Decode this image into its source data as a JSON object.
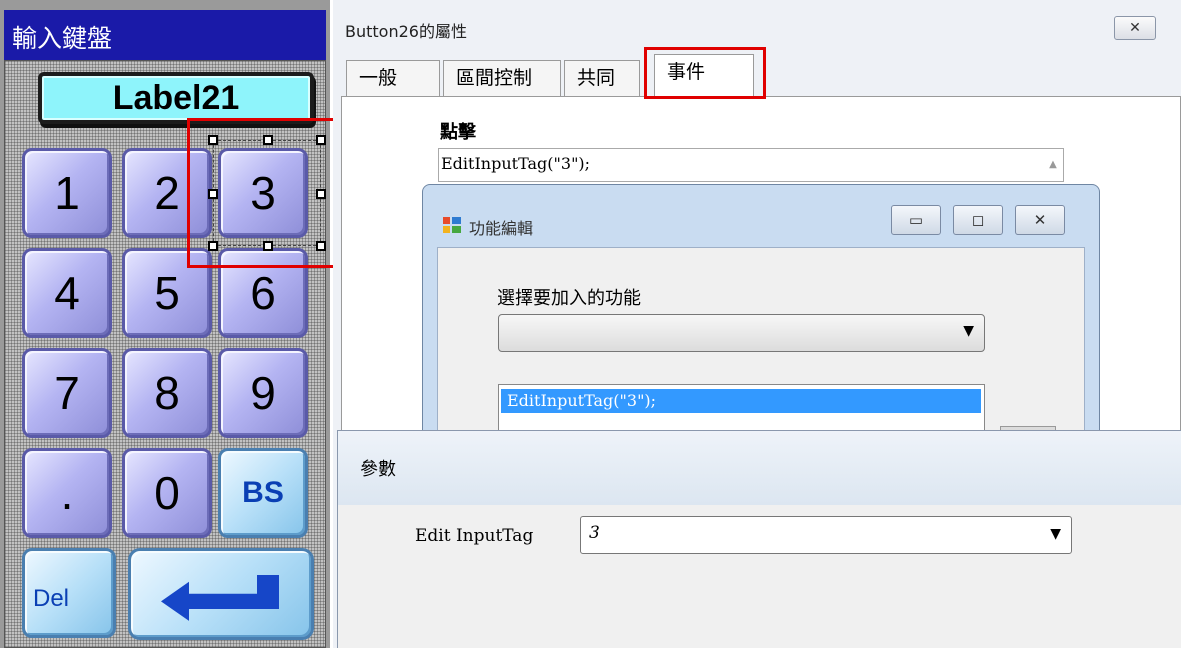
{
  "keypad": {
    "title": "輸入鍵盤",
    "label": "Label21",
    "keys": {
      "k1": "1",
      "k2": "2",
      "k3": "3",
      "k4": "4",
      "k5": "5",
      "k6": "6",
      "k7": "7",
      "k8": "8",
      "k9": "9",
      "dot": ".",
      "k0": "0",
      "bs": "BS",
      "del": "Del"
    },
    "enter_icon": "enter-arrow-icon"
  },
  "properties_window": {
    "title": "Button26的屬性",
    "close_icon": "close-icon",
    "tabs": [
      "一般",
      "區間控制",
      "共同",
      "事件"
    ],
    "selected_tab": "事件",
    "click_label": "點擊",
    "click_value": "EditInputTag(\"3\");"
  },
  "function_dialog": {
    "title": "功能編輯",
    "select_label": "選擇要加入的功能",
    "dropdown_value": "",
    "list_items": [
      "EditInputTag(\"3\");"
    ]
  },
  "param_dialog": {
    "title": "參數",
    "field_label": "Edit InputTag",
    "field_value": "3"
  },
  "colors": {
    "highlight_red": "#e00000",
    "selection_blue": "#3399ff",
    "keypad_title_bg": "#1a1aa8",
    "label_bg": "#8ef4fb"
  }
}
